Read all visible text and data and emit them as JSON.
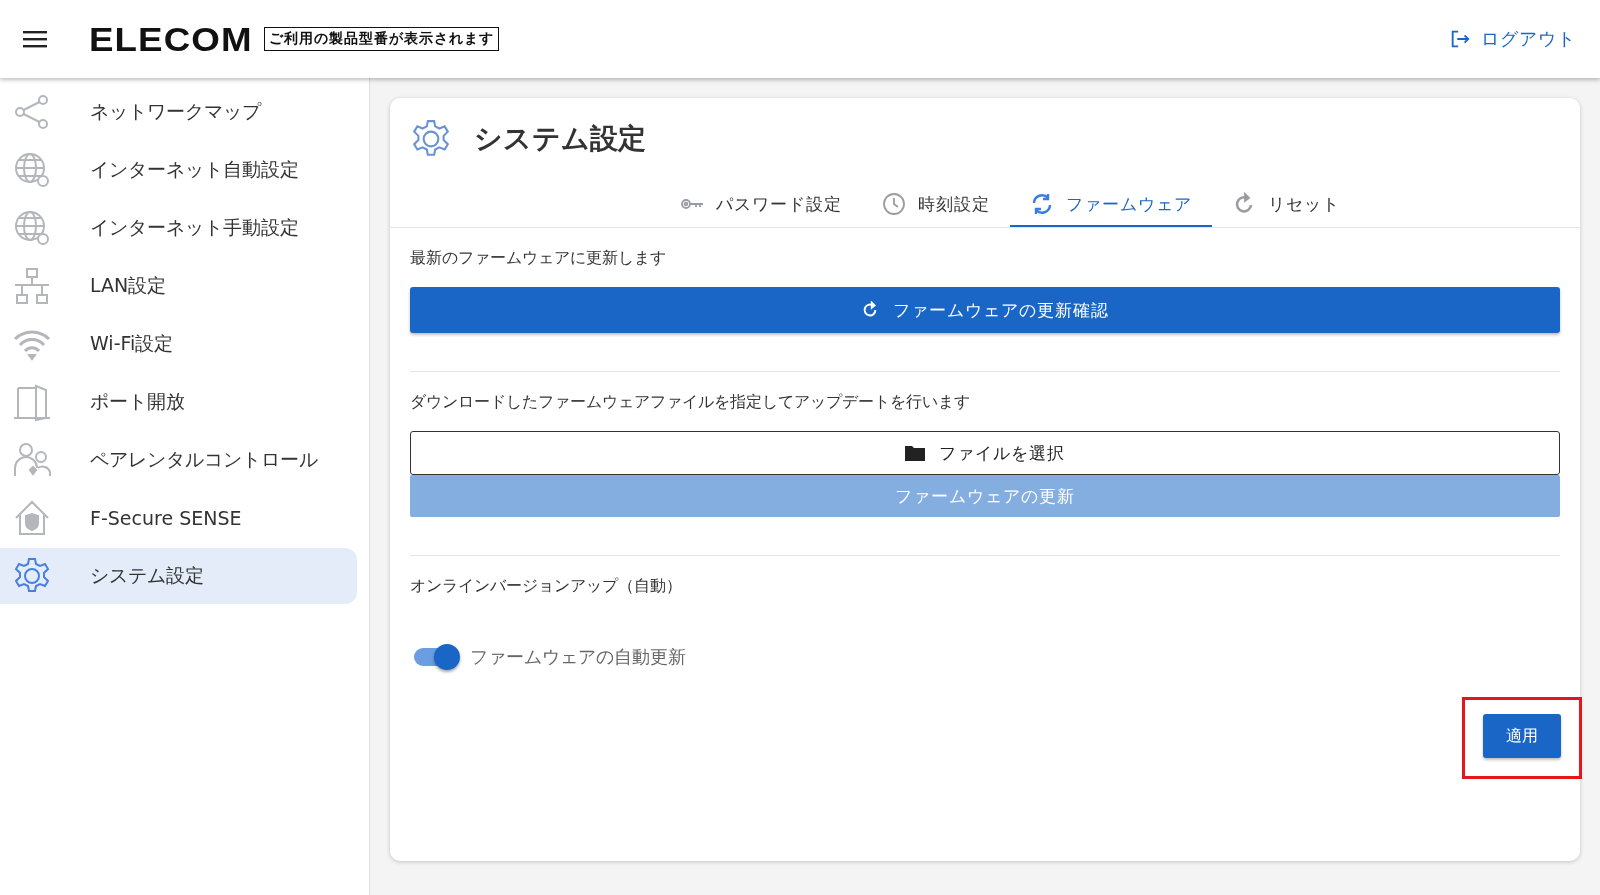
{
  "header": {
    "logo": "ELECOM",
    "model_label": "ご利用の製品型番が表示されます",
    "logout": "ログアウト"
  },
  "sidebar": {
    "items": [
      {
        "label": "ネットワークマップ",
        "selected": false
      },
      {
        "label": "インターネット自動設定",
        "selected": false
      },
      {
        "label": "インターネット手動設定",
        "selected": false
      },
      {
        "label": "LAN設定",
        "selected": false
      },
      {
        "label": "Wi-Fi設定",
        "selected": false
      },
      {
        "label": "ポート開放",
        "selected": false
      },
      {
        "label": "ペアレンタルコントロール",
        "selected": false
      },
      {
        "label": "F-Secure SENSE",
        "selected": false
      },
      {
        "label": "システム設定",
        "selected": true
      }
    ]
  },
  "page": {
    "title": "システム設定",
    "tabs": [
      {
        "label": "パスワード設定",
        "selected": false
      },
      {
        "label": "時刻設定",
        "selected": false
      },
      {
        "label": "ファームウェア",
        "selected": true
      },
      {
        "label": "リセット",
        "selected": false
      }
    ],
    "online_check": {
      "description": "最新のファームウェアに更新します",
      "button": "ファームウェアの更新確認"
    },
    "file_update": {
      "description": "ダウンロードしたファームウェアファイルを指定してアップデートを行います",
      "choose_button": "ファイルを選択",
      "update_button": {
        "label": "ファームウェアの更新",
        "disabled": true
      }
    },
    "auto_update": {
      "heading": "オンラインバージョンアップ（自動）",
      "toggle_label": "ファームウェアの自動更新",
      "on": true
    },
    "apply_button": {
      "label": "適用",
      "highlighted": true
    }
  }
}
